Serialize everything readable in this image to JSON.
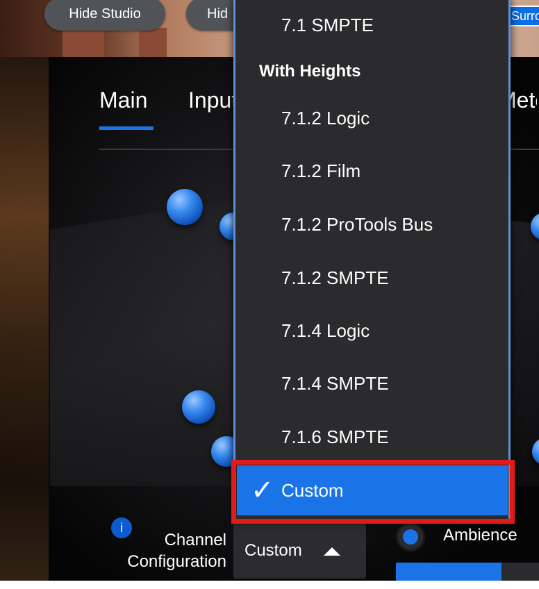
{
  "top_bar": {
    "hide_studio_label": "Hide Studio",
    "hide_overlay_label": "Hid",
    "surround_label": "Surro"
  },
  "tabs": [
    {
      "label": "Main",
      "active": true
    },
    {
      "label": "Input"
    },
    {
      "label": "Meter"
    }
  ],
  "dropdown": {
    "items_top": [
      "7.1 SMPTE"
    ],
    "section_header": "With Heights",
    "items_heights": [
      "7.1.2 Logic",
      "7.1.2 Film",
      "7.1.2 ProTools Bus",
      "7.1.2 SMPTE",
      "7.1.4 Logic",
      "7.1.4 SMPTE",
      "7.1.6 SMPTE"
    ],
    "selected_item": "Custom",
    "checkmark": "✓"
  },
  "controls": {
    "info_icon": "i",
    "channel_config_label_line1": "Channel",
    "channel_config_label_line2": "Configuration",
    "channel_config_value": "Custom",
    "ambience_label": "Ambience",
    "ambience_level": 0.74
  },
  "colors": {
    "accent": "#1a74e8",
    "highlight": "#e11a1a"
  }
}
